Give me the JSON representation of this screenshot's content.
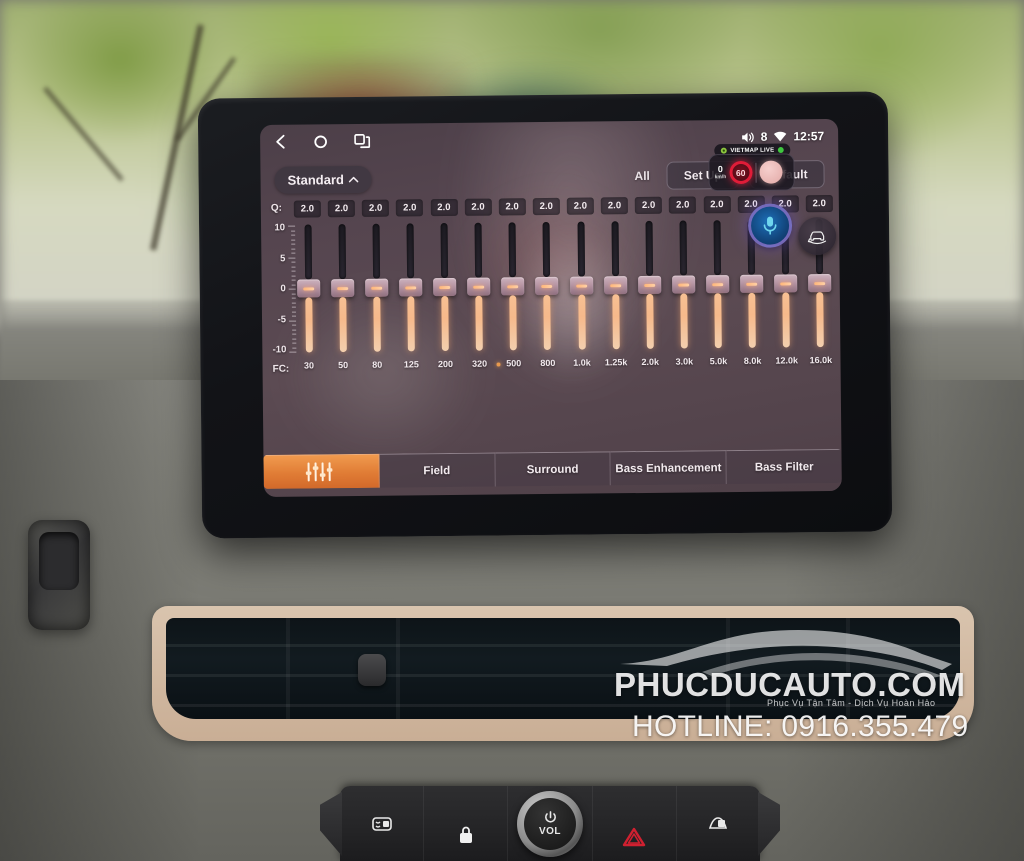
{
  "statusbar": {
    "nav": [
      {
        "name": "back-icon",
        "label": "Back"
      },
      {
        "name": "home-icon",
        "label": "Home"
      },
      {
        "name": "recents-icon",
        "label": "Recent apps"
      }
    ],
    "volume_level": "8",
    "clock": "12:57",
    "volume_icon": "speaker-icon",
    "wifi_icon": "wifi-icon"
  },
  "toolbar": {
    "preset_label": "Standard",
    "preset_chevron": "chevron-up-icon",
    "all_label": "All",
    "setup_label": "Set Up",
    "default_label": "Default"
  },
  "eq": {
    "q_label": "Q:",
    "fc_label": "FC:",
    "axis_labels": [
      "10",
      "5",
      "0",
      "-5",
      "-10"
    ],
    "selected_band_index": 6,
    "bands": [
      {
        "freq": "30",
        "q": "2.0",
        "gain": 0
      },
      {
        "freq": "50",
        "q": "2.0",
        "gain": 0
      },
      {
        "freq": "80",
        "q": "2.0",
        "gain": 0
      },
      {
        "freq": "125",
        "q": "2.0",
        "gain": 0
      },
      {
        "freq": "200",
        "q": "2.0",
        "gain": 0
      },
      {
        "freq": "320",
        "q": "2.0",
        "gain": 0
      },
      {
        "freq": "500",
        "q": "2.0",
        "gain": 0
      },
      {
        "freq": "800",
        "q": "2.0",
        "gain": 0
      },
      {
        "freq": "1.0k",
        "q": "2.0",
        "gain": 0
      },
      {
        "freq": "1.25k",
        "q": "2.0",
        "gain": 0
      },
      {
        "freq": "2.0k",
        "q": "2.0",
        "gain": 0
      },
      {
        "freq": "3.0k",
        "q": "2.0",
        "gain": 0
      },
      {
        "freq": "5.0k",
        "q": "2.0",
        "gain": 0
      },
      {
        "freq": "8.0k",
        "q": "2.0",
        "gain": 0
      },
      {
        "freq": "12.0k",
        "q": "2.0",
        "gain": 0
      },
      {
        "freq": "16.0k",
        "q": "2.0",
        "gain": 0
      }
    ]
  },
  "tabs": [
    {
      "label": "",
      "icon": "equalizer-icon",
      "active": true
    },
    {
      "label": "Field",
      "icon": "",
      "active": false
    },
    {
      "label": "Surround",
      "icon": "",
      "active": false
    },
    {
      "label": "Bass Enhancement",
      "icon": "",
      "active": false
    },
    {
      "label": "Bass Filter",
      "icon": "",
      "active": false
    }
  ],
  "vietmap": {
    "title": "VIETMAP LIVE",
    "speed_value": "0",
    "speed_unit": "km/h",
    "speed_limit": "60"
  },
  "floating": {
    "mic_icon": "microphone-icon",
    "car_icon": "car-360-icon"
  },
  "watermark": {
    "site": "PHUCDUCAUTO.COM",
    "tagline": "Phục Vụ Tận Tâm  -  Dịch Vụ Hoàn Hảo",
    "hotline": "HOTLINE: 0916.355.479"
  },
  "console": {
    "buttons": [
      {
        "name": "rear-defrost-button",
        "icon": "rear-defrost-icon"
      },
      {
        "name": "door-lock-button",
        "icon": "lock-icon"
      },
      {
        "name": "volume-power-knob",
        "icon": "power-icon",
        "label": "VOL"
      },
      {
        "name": "hazard-button",
        "icon": "hazard-triangle-icon"
      },
      {
        "name": "front-defrost-button",
        "icon": "front-defrost-icon"
      }
    ]
  },
  "colors": {
    "accent_orange": "#e07c35",
    "slider_fill": "#f6b98b",
    "mic_blue": "#1d6fb8",
    "speed_red": "#e01c38"
  }
}
